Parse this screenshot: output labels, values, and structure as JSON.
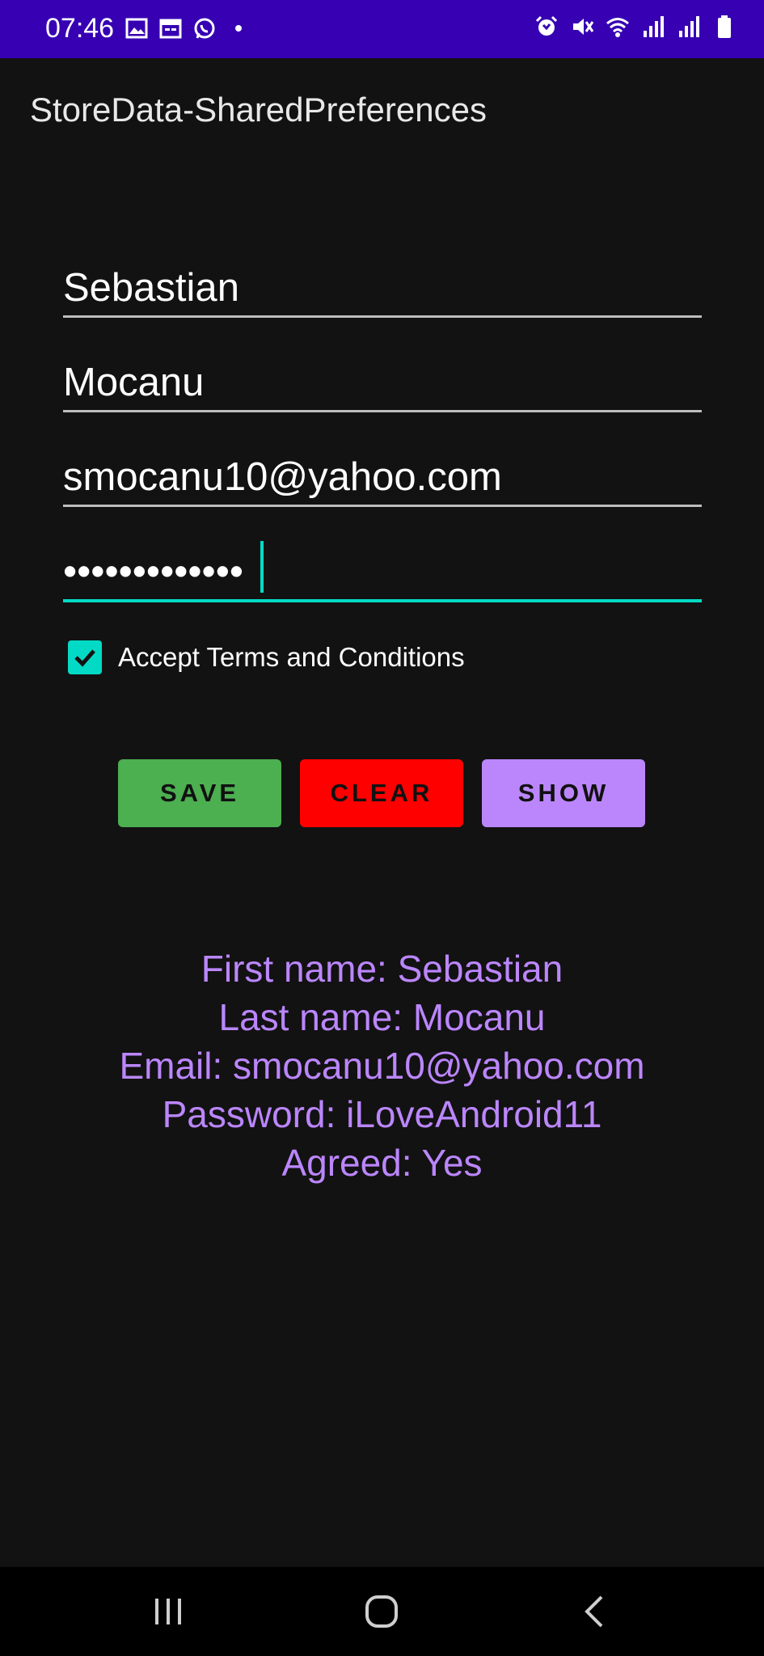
{
  "status_bar": {
    "time": "07:46",
    "left_icons": [
      "image-icon",
      "calendar-icon",
      "whatsapp-icon",
      "dot-icon"
    ],
    "right_icons": [
      "alarm-icon",
      "mute-icon",
      "wifi-icon",
      "signal-icon",
      "signal-icon",
      "battery-icon"
    ]
  },
  "app_bar": {
    "title": "StoreData-SharedPreferences"
  },
  "form": {
    "first_name": "Sebastian",
    "last_name": "Mocanu",
    "email": "smocanu10@yahoo.com",
    "password_masked": "•••••••••••••",
    "accept_label": "Accept Terms and Conditions",
    "accept_checked": true
  },
  "buttons": {
    "save": "SAVE",
    "clear": "CLEAR",
    "show": "SHOW"
  },
  "colors": {
    "status_bar": "#3700b3",
    "accent": "#03dac5",
    "save": "#4caf50",
    "clear": "#ff0000",
    "show": "#bb86fc",
    "result_text": "#bb86fc"
  },
  "result": {
    "first_name": "First name: Sebastian",
    "last_name": "Last name: Mocanu",
    "email": "Email: smocanu10@yahoo.com",
    "password": "Password: iLoveAndroid11",
    "agreed": "Agreed: Yes"
  },
  "nav_bar": {
    "items": [
      "recents-icon",
      "home-icon",
      "back-icon"
    ]
  }
}
